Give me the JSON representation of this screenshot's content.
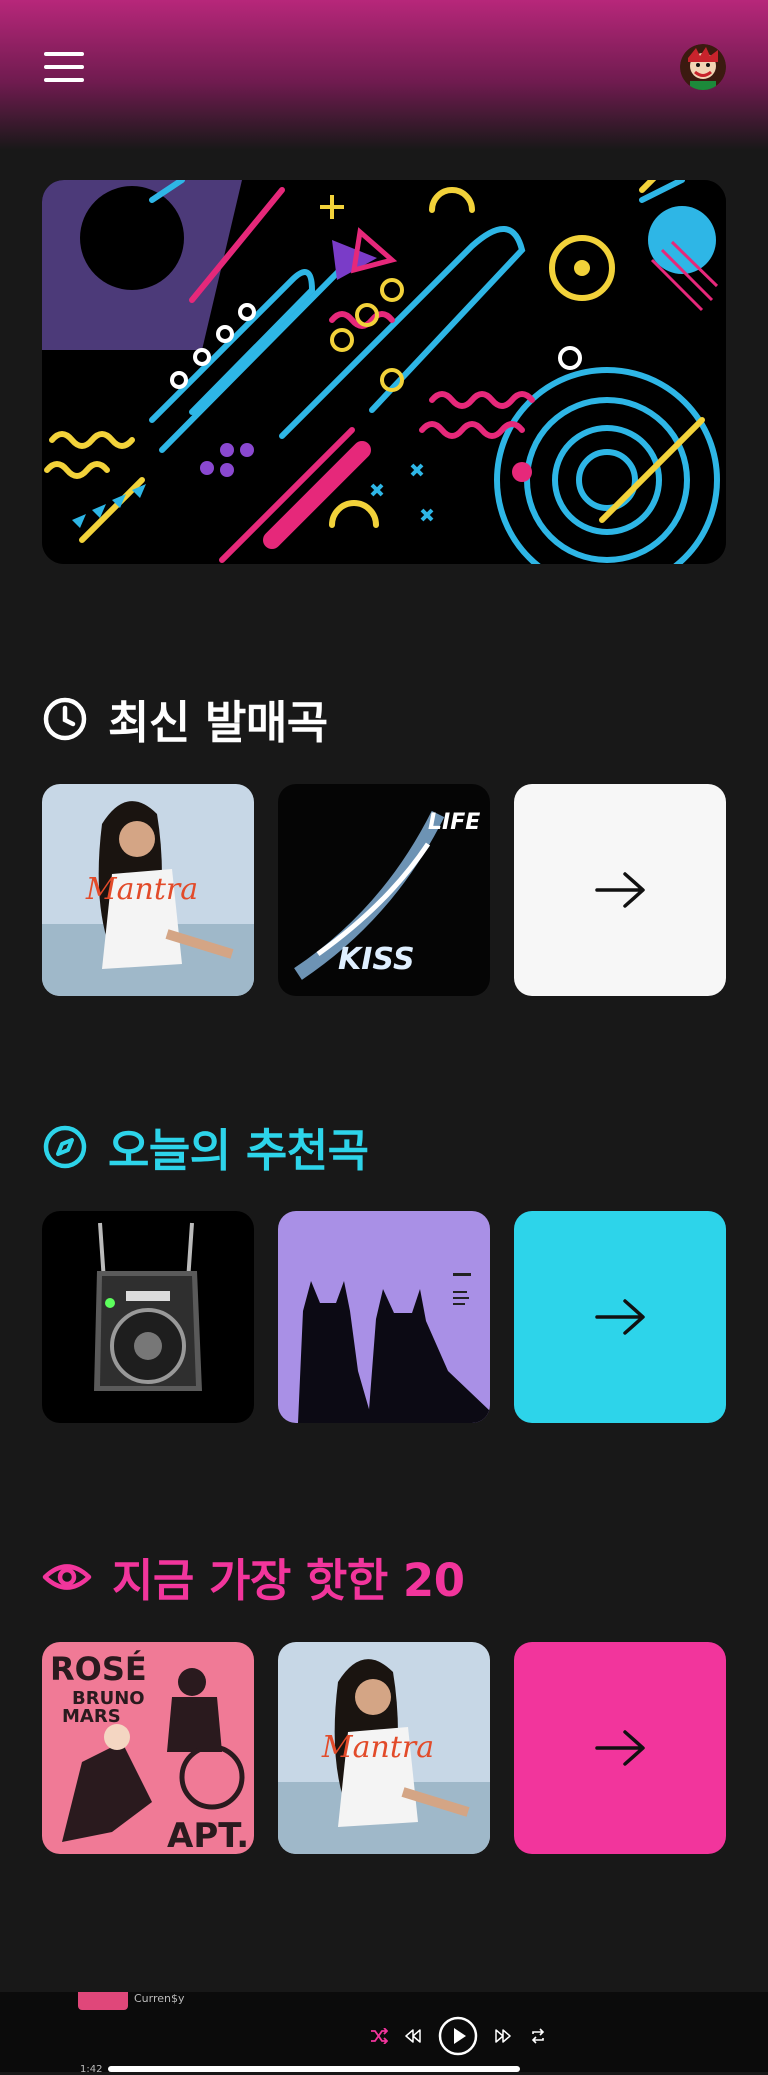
{
  "sections": [
    {
      "title": "최신 발매곡",
      "icon": "clock-icon",
      "color": "#ffffff"
    },
    {
      "title": "오늘의 추천곡",
      "icon": "compass-icon",
      "color": "#2dd4ea"
    },
    {
      "title": "지금 가장 핫한 20",
      "icon": "eye-icon",
      "color": "#f2359c"
    }
  ],
  "albums": {
    "hot1_line1": "ROSÉ",
    "hot1_line2": "BRUNO",
    "hot1_line3": "MARS",
    "hot1_line4": "APT.",
    "mantra": "Mantra",
    "kiss": "KISS",
    "life": "LIFE"
  },
  "colors": {
    "accent_cyan": "#2dd4ea",
    "accent_pink": "#f2359c",
    "card_white": "#f7f7f7",
    "header_magenta": "#b7277a"
  },
  "player": {
    "artist": "Curren$y",
    "time": "1:42",
    "progress_fraction": 0.76
  }
}
